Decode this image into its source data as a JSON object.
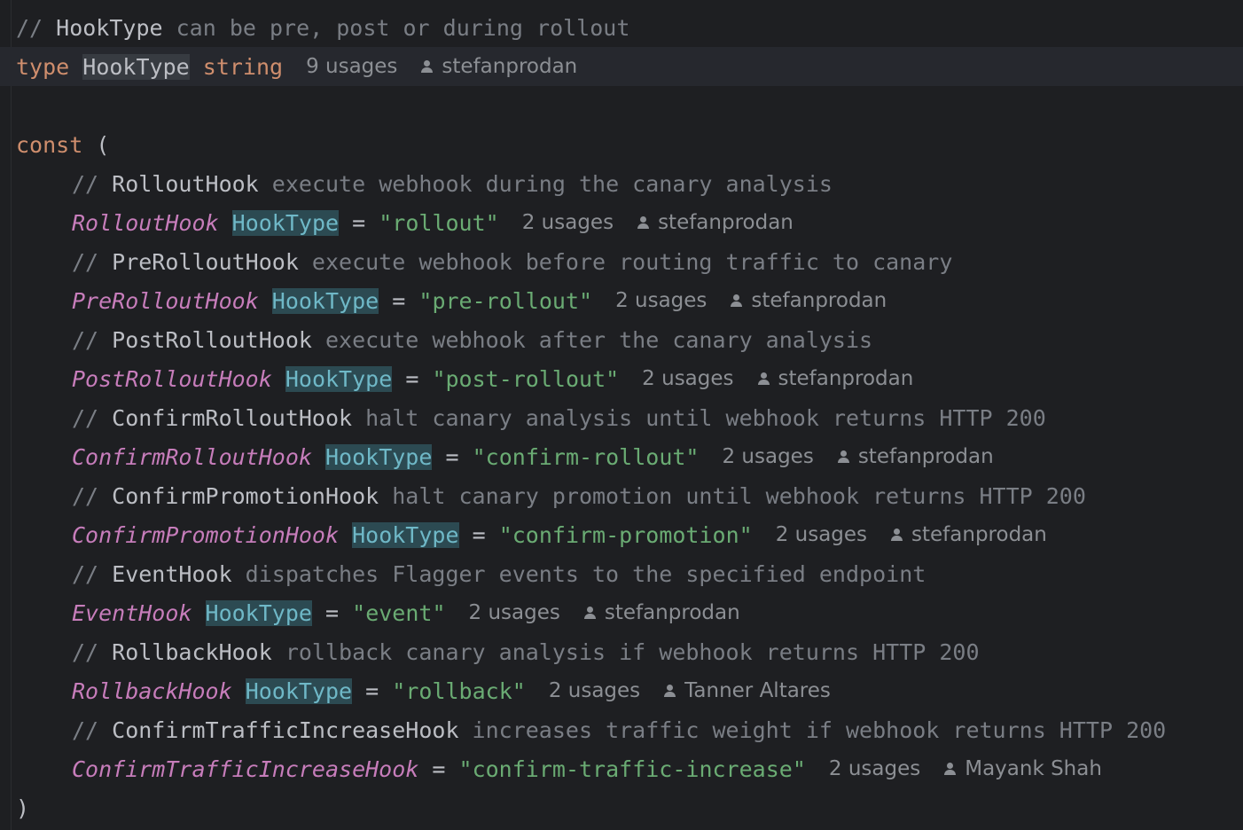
{
  "editor": {
    "lines": [
      {
        "kind": "comment",
        "indent": 0,
        "ident": "HookType",
        "text": " can be pre, post or during rollout"
      },
      {
        "kind": "typedecl",
        "keyword": "type",
        "name": "HookType",
        "type": "string",
        "usages": "9 usages",
        "author": "stefanprodan"
      },
      {
        "kind": "blank"
      },
      {
        "kind": "open",
        "keyword": "const",
        "paren": "("
      },
      {
        "kind": "comment",
        "indent": 1,
        "ident": "RolloutHook",
        "text": " execute webhook during the canary analysis"
      },
      {
        "kind": "const",
        "name": "RolloutHook",
        "type": "HookType",
        "value": "\"rollout\"",
        "usages": "2 usages",
        "author": "stefanprodan"
      },
      {
        "kind": "comment",
        "indent": 1,
        "ident": "PreRolloutHook",
        "text": " execute webhook before routing traffic to canary"
      },
      {
        "kind": "const",
        "name": "PreRolloutHook",
        "type": "HookType",
        "value": "\"pre-rollout\"",
        "usages": "2 usages",
        "author": "stefanprodan"
      },
      {
        "kind": "comment",
        "indent": 1,
        "ident": "PostRolloutHook",
        "text": " execute webhook after the canary analysis"
      },
      {
        "kind": "const",
        "name": "PostRolloutHook",
        "type": "HookType",
        "value": "\"post-rollout\"",
        "usages": "2 usages",
        "author": "stefanprodan"
      },
      {
        "kind": "comment",
        "indent": 1,
        "ident": "ConfirmRolloutHook",
        "text": " halt canary analysis until webhook returns HTTP 200"
      },
      {
        "kind": "const",
        "name": "ConfirmRolloutHook",
        "type": "HookType",
        "value": "\"confirm-rollout\"",
        "usages": "2 usages",
        "author": "stefanprodan"
      },
      {
        "kind": "comment",
        "indent": 1,
        "ident": "ConfirmPromotionHook",
        "text": " halt canary promotion until webhook returns HTTP 200"
      },
      {
        "kind": "const",
        "name": "ConfirmPromotionHook",
        "type": "HookType",
        "value": "\"confirm-promotion\"",
        "usages": "2 usages",
        "author": "stefanprodan"
      },
      {
        "kind": "comment",
        "indent": 1,
        "ident": "EventHook",
        "text": " dispatches Flagger events to the specified endpoint"
      },
      {
        "kind": "const",
        "name": "EventHook",
        "type": "HookType",
        "value": "\"event\"",
        "usages": "2 usages",
        "author": "stefanprodan"
      },
      {
        "kind": "comment",
        "indent": 1,
        "ident": "RollbackHook",
        "text": " rollback canary analysis if webhook returns HTTP 200"
      },
      {
        "kind": "const",
        "name": "RollbackHook",
        "type": "HookType",
        "value": "\"rollback\"",
        "usages": "2 usages",
        "author": "Tanner Altares"
      },
      {
        "kind": "comment",
        "indent": 1,
        "ident": "ConfirmTrafficIncreaseHook",
        "text": " increases traffic weight if webhook returns HTTP 200"
      },
      {
        "kind": "const",
        "name": "ConfirmTrafficIncreaseHook",
        "type": "",
        "value": "\"confirm-traffic-increase\"",
        "usages": "2 usages",
        "author": "Mayank Shah"
      },
      {
        "kind": "close",
        "paren": ")"
      }
    ],
    "comment_prefix": "// ",
    "equals": "=",
    "highlighted_line": 1,
    "icons": {
      "author": "person-icon"
    },
    "colors": {
      "background": "#1e1f22",
      "keyword": "#cf8e6d",
      "constant": "#c77dbb",
      "string": "#6aab73",
      "comment": "#7a7e85",
      "type_ref": "#6fb8c7",
      "hint": "#8c8f94"
    }
  }
}
